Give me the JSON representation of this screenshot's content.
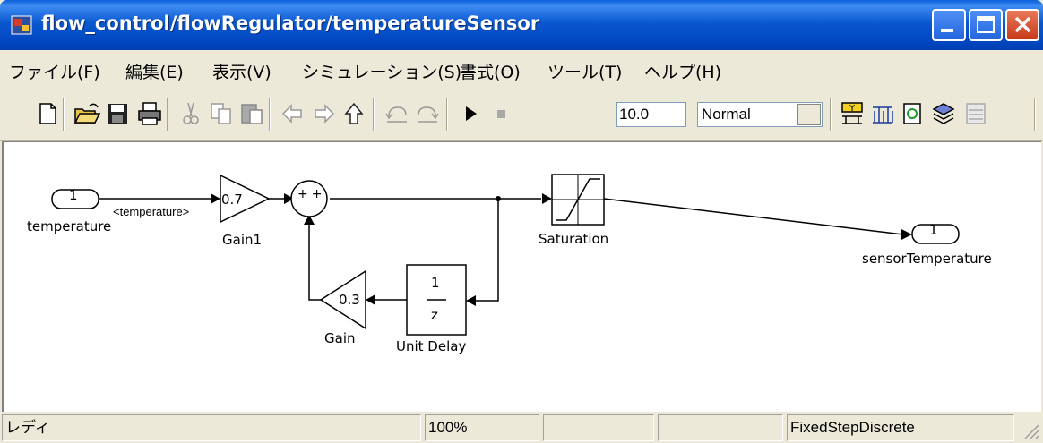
{
  "window": {
    "title": "flow_control/flowRegulator/temperatureSensor"
  },
  "menu": [
    "ファイル(F)",
    "編集(E)",
    "表示(V)",
    "シミュレーション(S)",
    "書式(O)",
    "ツール(T)",
    "ヘルプ(H)"
  ],
  "toolbar": {
    "stop_time": "10.0",
    "sim_mode": "Normal",
    "icons": [
      "new-icon",
      "open-icon",
      "save-icon",
      "print-icon",
      "cut-icon",
      "copy-icon",
      "paste-icon",
      "back-icon",
      "forward-icon",
      "up-icon",
      "undo-icon",
      "redo-icon",
      "play-icon",
      "stop-icon",
      "dropdown-icon",
      "library-icon",
      "model-explorer-icon",
      "update-icon",
      "build-icon",
      "debug-icon"
    ]
  },
  "diagram": {
    "inport": {
      "number": "1",
      "name": "temperature",
      "signal_label": "<temperature>"
    },
    "gain1": {
      "value": "0.7",
      "name": "Gain1"
    },
    "sum": {
      "signs": "++"
    },
    "saturation": {
      "name": "Saturation"
    },
    "outport": {
      "number": "1",
      "name": "sensorTemperature"
    },
    "gain": {
      "value": "0.3",
      "name": "Gain"
    },
    "unit_delay": {
      "numerator": "1",
      "denominator": "z",
      "name": "Unit Delay"
    }
  },
  "status": {
    "state": "レディ",
    "zoom": "100%",
    "solver": "FixedStepDiscrete"
  }
}
